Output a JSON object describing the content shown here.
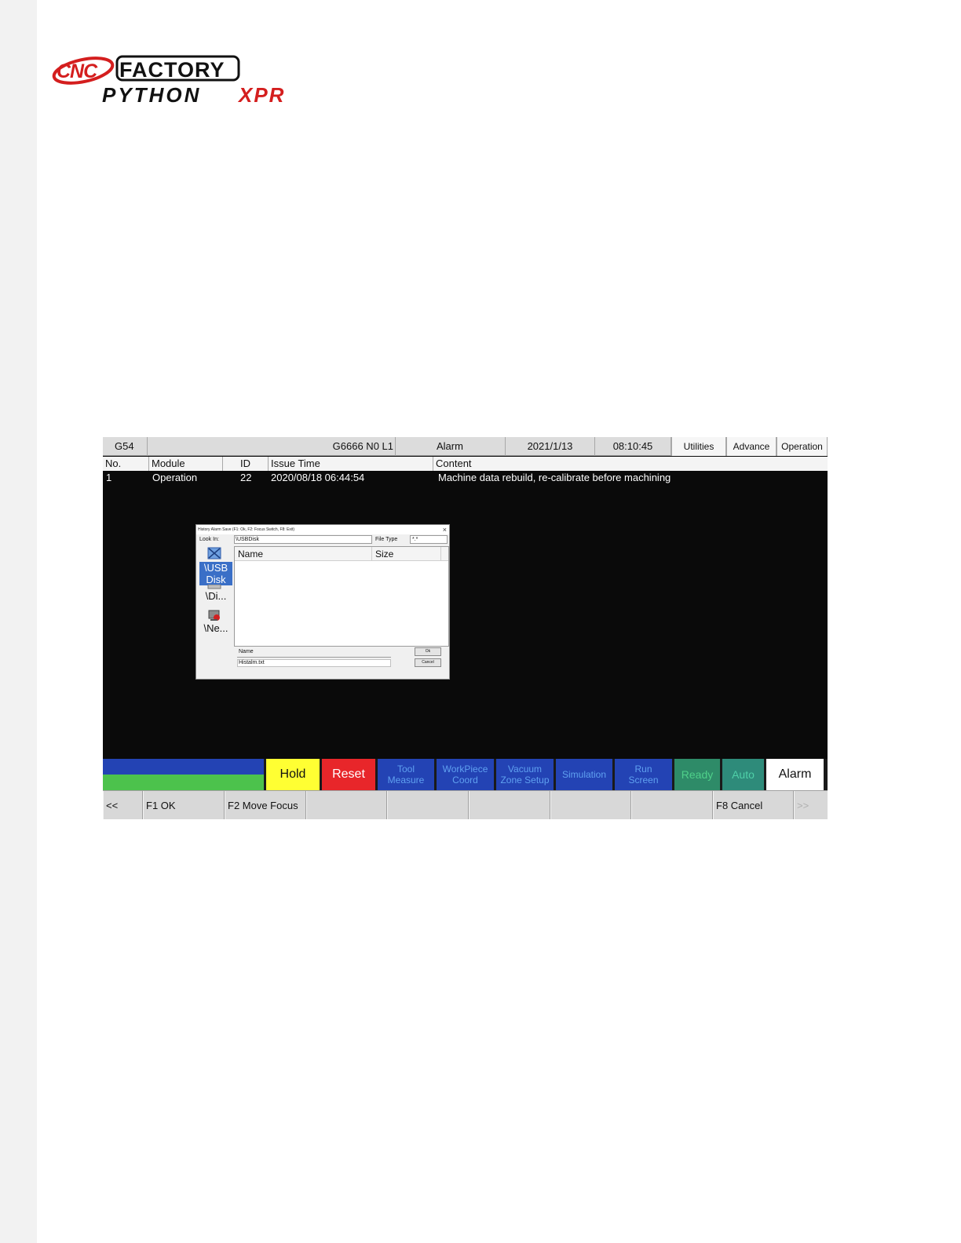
{
  "logo": {
    "brand_cnc": "CNC",
    "brand_factory": "FACTORY",
    "product_python": "PYTHON",
    "product_xpr": "XPR"
  },
  "topbar": {
    "coord_system": "G54",
    "program": "G6666 N0 L1",
    "mode": "Alarm",
    "date": "2021/1/13",
    "time": "08:10:45",
    "buttons": [
      "Utilities",
      "Advance",
      "Operation"
    ]
  },
  "alarm_table": {
    "columns": [
      "No.",
      "Module",
      "ID",
      "Issue Time",
      "Content"
    ],
    "rows": [
      {
        "no": "1",
        "module": "Operation",
        "id": "22",
        "issue_time": "2020/08/18 06:44:54",
        "content": "Machine data rebuild, re-calibrate before machining"
      }
    ]
  },
  "dialog": {
    "title": "History Alarm Save (F1: Ok, F2: Focus Switch, F8: Exit)",
    "close": "×",
    "look_in_label": "Look In:",
    "look_in_value": "\\USBDisk",
    "file_type_label": "File Type",
    "file_type_value": "*.*",
    "places": [
      "\\USB Disk",
      "\\Di...",
      "\\Ne..."
    ],
    "list_columns": [
      "Name",
      "Size"
    ],
    "name_label": "Name",
    "name_value": "Histalm.txt",
    "ok_label": "Ok",
    "cancel_label": "Cancel"
  },
  "status_bar": {
    "hold": "Hold",
    "reset": "Reset",
    "tool_measure": "Tool Measure",
    "workpiece_coord": "WorkPiece Coord",
    "vacuum_zone_setup": "Vacuum Zone Setup",
    "simulation": "Simulation",
    "run_screen": "Run Screen",
    "ready": "Ready",
    "auto": "Auto",
    "alarm": "Alarm"
  },
  "function_keys": {
    "prev": "<<",
    "f1": "F1 OK",
    "f2": "F2 Move Focus",
    "f8": "F8 Cancel",
    "next": ">>"
  },
  "colors": {
    "screen_bg": "#0a0a0a",
    "hold": "#ffff33",
    "reset": "#e8262a",
    "blue_key": "#2343b4",
    "blue_key_text": "#5fa0f0",
    "ready": "#2e8b68",
    "auto": "#2e8b7a",
    "green_bar": "#4cc24c",
    "selected_place": "#3a6fc7",
    "logo_red": "#d41e1e"
  }
}
